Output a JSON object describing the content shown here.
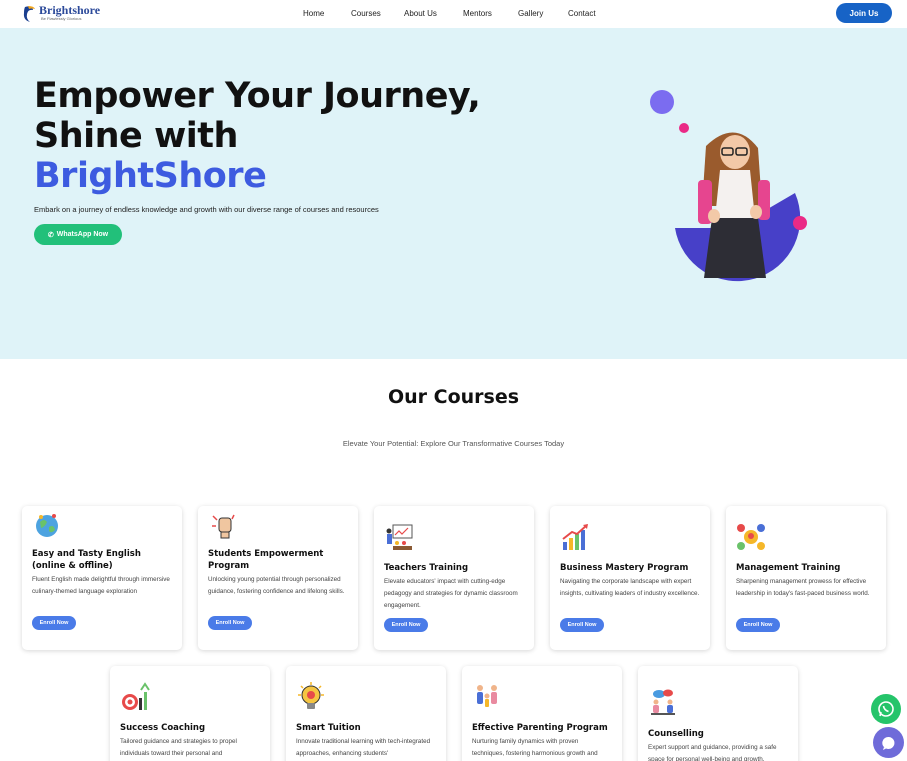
{
  "header": {
    "logo_name": "Brightshore",
    "logo_tagline": "Be Flawlessly Glorious",
    "nav": [
      "Home",
      "Courses",
      "About Us",
      "Mentors",
      "Gallery",
      "Contact"
    ],
    "join_label": "Join Us"
  },
  "hero": {
    "title_line1": "Empower Your Journey,",
    "title_line2": "Shine with",
    "title_brand": "BrightShore",
    "subtitle": "Embark on a journey of endless knowledge and growth with our diverse range of courses and resources",
    "whatsapp_label": "WhatsApp Now"
  },
  "courses": {
    "title": "Our Courses",
    "subtitle": "Elevate Your Potential: Explore Our Transformative Courses Today",
    "enroll_label": "Enroll Now",
    "items": [
      {
        "title": "Easy and Tasty English (online & offline)",
        "desc": "Fluent English made delightful through immersive culinary-themed language exploration",
        "icon": "globe-icon"
      },
      {
        "title": "Students Empowerment Program",
        "desc": "Unlocking young potential through personalized guidance, fostering confidence and lifelong skills.",
        "icon": "raised-fist-icon"
      },
      {
        "title": "Teachers Training",
        "desc": "Elevate educators' impact with cutting-edge pedagogy and strategies for dynamic classroom engagement.",
        "icon": "classroom-icon"
      },
      {
        "title": "Business Mastery Program",
        "desc": "Navigating the corporate landscape with expert insights, cultivating leaders of industry excellence.",
        "icon": "growth-chart-icon"
      },
      {
        "title": "Management Training",
        "desc": "Sharpening management prowess for effective leadership in today's fast-paced business world.",
        "icon": "team-network-icon"
      },
      {
        "title": "Success Coaching",
        "desc": "Tailored guidance and strategies to propel individuals toward their personal and",
        "icon": "target-icon"
      },
      {
        "title": "Smart Tuition",
        "desc": "Innovate traditional learning with tech-integrated approaches, enhancing students'",
        "icon": "lightbulb-icon"
      },
      {
        "title": "Effective Parenting Program",
        "desc": "Nurturing family dynamics with proven techniques, fostering harmonious growth and",
        "icon": "family-icon"
      },
      {
        "title": "Counselling",
        "desc": "Expert support and guidance, providing a safe space for personal well-being and growth.",
        "icon": "counselling-icon"
      }
    ]
  },
  "colors": {
    "brand_blue": "#3d5be0",
    "join_blue": "#1763c6",
    "whatsapp_green": "#22c07a",
    "hero_bg": "#dff3f8",
    "enroll_blue": "#4a7be8"
  }
}
